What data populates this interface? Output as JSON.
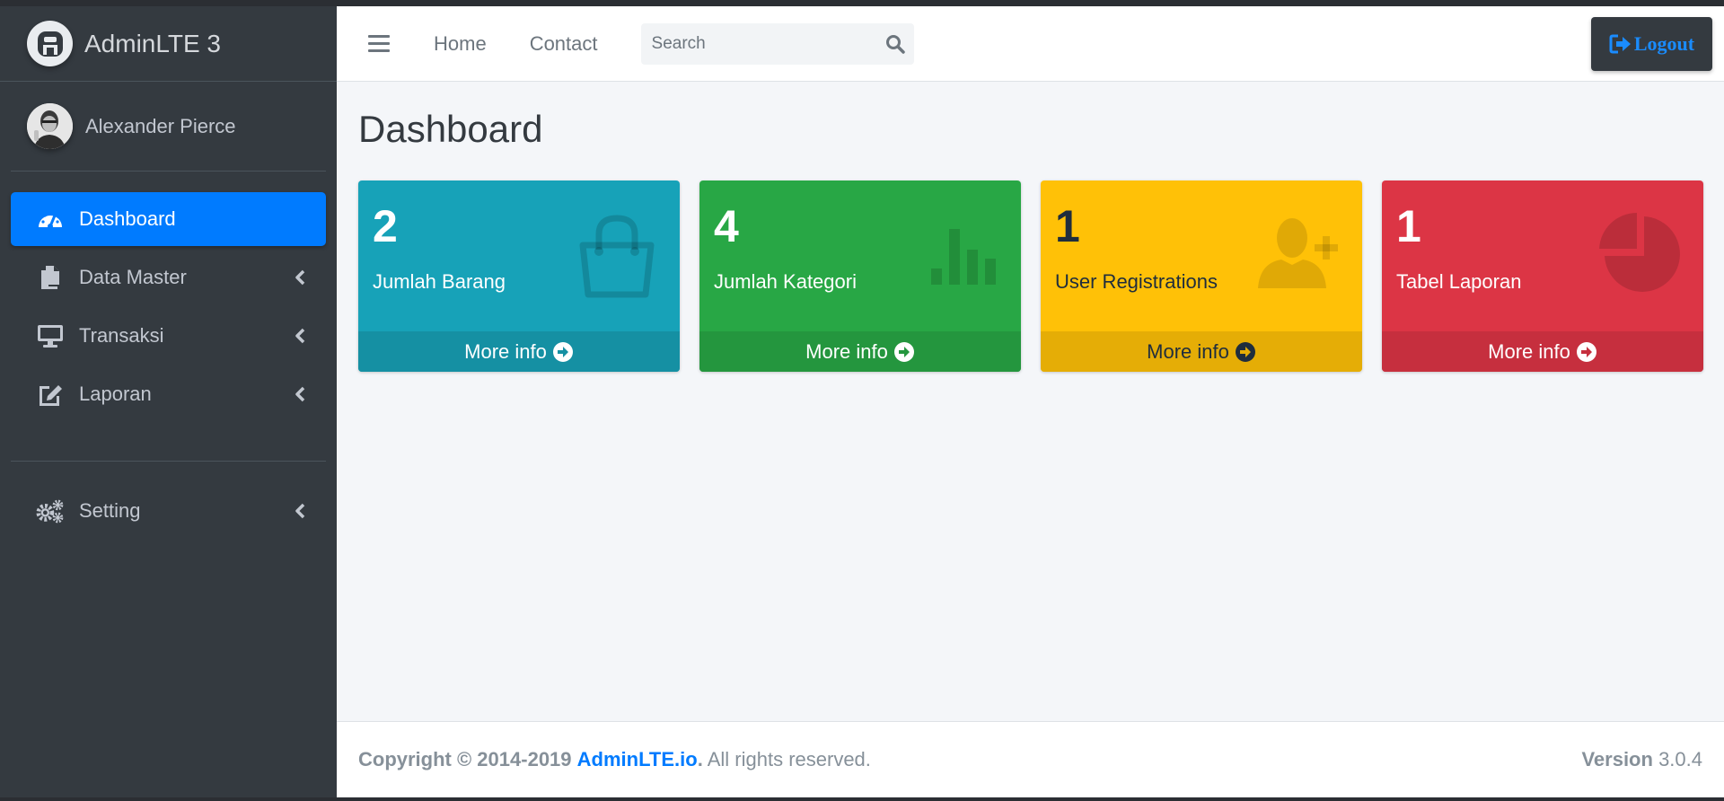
{
  "brand": {
    "text": "AdminLTE 3",
    "logo_icon": "adminlte-logo-icon"
  },
  "user": {
    "name": "Alexander Pierce",
    "avatar_icon": "avatar"
  },
  "sidebar": {
    "items": [
      {
        "label": "Dashboard",
        "icon": "tachometer-icon",
        "active": true
      },
      {
        "label": "Data Master",
        "icon": "copy-icon",
        "chevron": true
      },
      {
        "label": "Transaksi",
        "icon": "desktop-icon",
        "chevron": true
      },
      {
        "label": "Laporan",
        "icon": "edit-icon",
        "chevron": true
      },
      {
        "label": "Setting",
        "icon": "cogs-icon",
        "chevron": true
      }
    ]
  },
  "navbar": {
    "links": [
      "Home",
      "Contact"
    ],
    "search_placeholder": "Search",
    "logout_label": "Logout"
  },
  "page": {
    "title": "Dashboard"
  },
  "cards": [
    {
      "value": "2",
      "label": "Jumlah Barang",
      "footer": "More info",
      "icon": "shopping-bag-icon",
      "color": "#17a2b8"
    },
    {
      "value": "4",
      "label": "Jumlah Kategori",
      "footer": "More info",
      "icon": "bar-chart-icon",
      "color": "#28a745"
    },
    {
      "value": "1",
      "label": "User Registrations",
      "footer": "More info",
      "icon": "user-plus-icon",
      "color": "#ffc107"
    },
    {
      "value": "1",
      "label": "Tabel Laporan",
      "footer": "More info",
      "icon": "pie-chart-icon",
      "color": "#dc3545"
    }
  ],
  "footer": {
    "copyright": "Copyright © 2014-2019",
    "brand_link": "AdminLTE.io",
    "dot": ".",
    "rights": "All rights reserved.",
    "version_label": "Version",
    "version_value": "3.0.4"
  }
}
